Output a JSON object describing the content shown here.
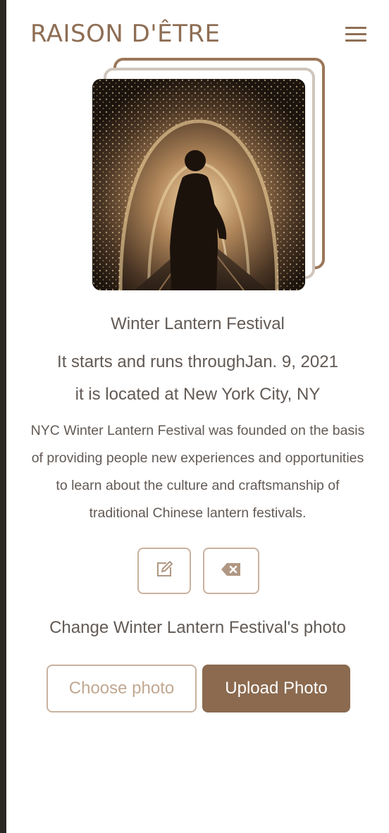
{
  "header": {
    "brand": "RAISON D'ÊTRE",
    "menu_icon": "hamburger-menu-icon"
  },
  "event": {
    "photo_description_icon": "festival-photo",
    "title": "Winter Lantern Festival",
    "dates_text": "It starts and runs throughJan. 9, 2021",
    "location_text": "it is located at New York City, NY",
    "description_lines": [
      "NYC Winter Lantern Festival was founded on the basis",
      "of providing people new experiences and opportunities",
      "to learn about the culture and craftsmanship of",
      "traditional Chinese lantern festivals."
    ]
  },
  "actions": {
    "edit_icon": "edit-icon",
    "delete_icon": "backspace-delete-icon"
  },
  "photo_upload": {
    "label": "Change Winter Lantern Festival's photo",
    "choose_label": "Choose photo",
    "upload_label": "Upload Photo"
  },
  "colors": {
    "brand": "#8e6e54",
    "text": "#625a55",
    "border": "#c9b29f",
    "primary_button": "#8b6a4f"
  }
}
